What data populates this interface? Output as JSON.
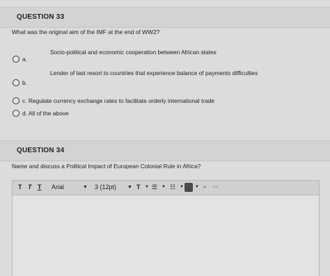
{
  "question33": {
    "header": "QUESTION 33",
    "prompt": "What was the original aim of the IMF at the end of WW2?",
    "options": [
      {
        "letter": "a.",
        "text": "Socio-political and economic cooperation between African states"
      },
      {
        "letter": "b.",
        "text": "Lender of last resort to countries that experience balance of payments difficulties"
      },
      {
        "letter": "c.",
        "text": "c. Regulate currency exchange rates to facilitate orderly international trade"
      },
      {
        "letter": "d.",
        "text": "d. All of the above"
      }
    ]
  },
  "question34": {
    "header": "QUESTION 34",
    "prompt": "Name and discuss a Political Impact of European Colonial Rule in Africa?"
  },
  "toolbar": {
    "font_family": "Arial",
    "font_size": "3 (12pt)",
    "text_format_glyph": "T",
    "bullet_glyph": "☰",
    "numbered_glyph": "☷"
  }
}
